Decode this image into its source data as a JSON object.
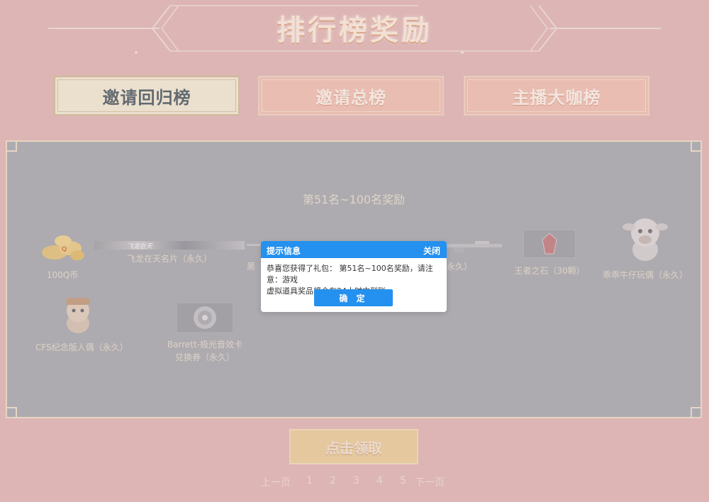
{
  "header": {
    "title": "排行榜奖励"
  },
  "tabs": [
    {
      "label": "邀请回归榜",
      "active": true
    },
    {
      "label": "邀请总榜",
      "active": false
    },
    {
      "label": "主播大咖榜",
      "active": false
    }
  ],
  "panel": {
    "title": "第51名~100名奖励",
    "rewards": [
      {
        "name": "100Q币",
        "icon": "qcoin-icon"
      },
      {
        "name": "飞龙在天名片（永久）",
        "icon": "name-card-icon",
        "card_text": "飞龙在天"
      },
      {
        "name": "黑",
        "icon": "rifle-icon"
      },
      {
        "name": "永久）",
        "icon": "rifle-icon"
      },
      {
        "name": "王者之石（30颗）",
        "icon": "king-stone-icon"
      },
      {
        "name": "乖乖牛仔玩偶（永久）",
        "icon": "cow-doll-icon"
      },
      {
        "name": "CFS纪念版人偶（永久）",
        "icon": "doll-icon"
      },
      {
        "name": "Barrett-极光音效卡兑换券（永久）",
        "name_line1": "Barrett-极光音效卡",
        "name_line2": "兑换券（永久）",
        "icon": "sound-card-icon"
      }
    ]
  },
  "claim_button": {
    "label": "点击领取"
  },
  "pagination": {
    "prev": "上一页",
    "pages": [
      "1",
      "2",
      "3",
      "4",
      "5"
    ],
    "next": "下一页"
  },
  "dialog": {
    "title": "提示信息",
    "close": "关闭",
    "message_line1": "恭喜您获得了礼包： 第51名~100名奖励，请注意：游戏",
    "message_line2": "虚拟道具奖品将会在24小时内到账",
    "confirm": "确 定"
  },
  "colors": {
    "background": "#e7c3c2",
    "panel": "#b1b8bc",
    "dialog_blue": "#2490ef",
    "claim": "#f1d9a9"
  }
}
